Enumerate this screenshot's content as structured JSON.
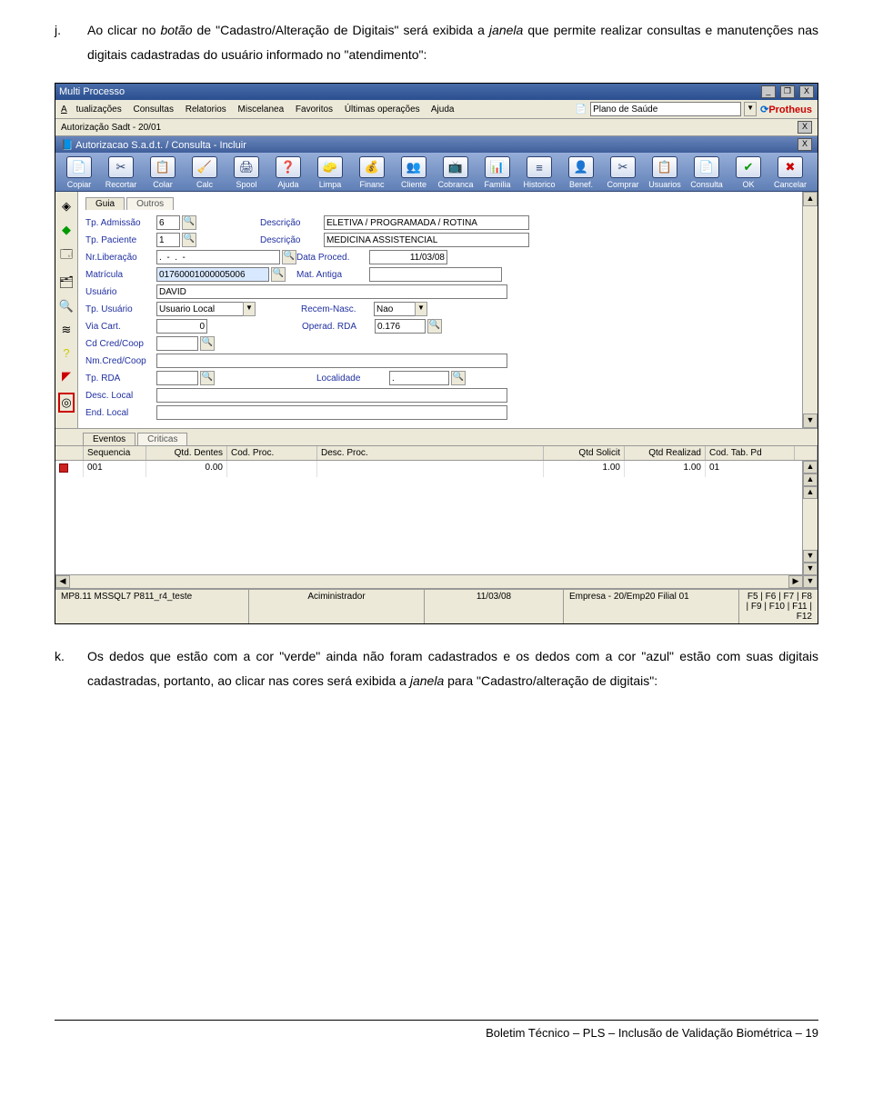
{
  "doc": {
    "j_marker": "j.",
    "j_text_1": "Ao clicar no ",
    "j_botao": "botão",
    "j_text_2": " de \"Cadastro/Alteração de Digitais\" será exibida a ",
    "j_janela": "janela",
    "j_text_3": " que permite realizar consultas e manutenções nas digitais cadastradas do usuário informado no \"atendimento\":",
    "k_marker": "k.",
    "k_text_1": "Os dedos que estão com a cor \"verde\" ainda não foram cadastrados e os dedos com a cor \"azul\" estão com suas digitais cadastradas, portanto, ao clicar nas cores será exibida a ",
    "k_janela": "janela",
    "k_text_2": " para \"Cadastro/alteração de digitais\":",
    "footer": "Boletim Técnico – PLS – Inclusão de Validação Biométrica – 19"
  },
  "app": {
    "title": "Multi Processo",
    "menu": {
      "m1": "Atualizações",
      "m2": "Consultas",
      "m3": "Relatorios",
      "m4": "Miscelanea",
      "m5": "Favoritos",
      "m6": "Últimas operações",
      "m7": "Ajuda"
    },
    "combo": "Plano de Saúde",
    "brand": "Protheus",
    "subtitle": "Autorização Sadt - 20/01",
    "wintitle": "Autorizacao S.a.d.t. / Consulta - Incluir",
    "toolbar": [
      "Copiar",
      "Recortar",
      "Colar",
      "Calc",
      "Spool",
      "Ajuda",
      "Limpa",
      "Financ",
      "Cliente",
      "Cobranca",
      "Familia",
      "Historico",
      "Benef.",
      "Comprar",
      "Usuarios",
      "Consulta",
      "OK",
      "Cancelar"
    ],
    "ticons": [
      "📄",
      "✂",
      "📋",
      "🧹",
      "🖨",
      "❓",
      "🧽",
      "💰",
      "👥",
      "📺",
      "📊",
      "≡",
      "👤",
      "✂",
      "📋",
      "📄",
      "✔",
      "✖"
    ],
    "tabs": {
      "guia": "Guia",
      "outros": "Outros"
    },
    "form": {
      "tpadm_l": "Tp. Admissão",
      "tpadm_v": "6",
      "desc1_l": "Descrição",
      "desc1_v": "ELETIVA / PROGRAMADA / ROTINA",
      "tppac_l": "Tp. Paciente",
      "tppac_v": "1",
      "desc2_l": "Descrição",
      "desc2_v": "MEDICINA ASSISTENCIAL",
      "nrlib_l": "Nr.Liberação",
      "nrlib_v": ".  -  .  -",
      "data_l": "Data Proced.",
      "data_v": "11/03/08",
      "mat_l": "Matrícula",
      "mat_v": "01760001000005006",
      "matant_l": "Mat. Antiga",
      "usu_l": "Usuário",
      "usu_v": "DAVID",
      "tpu_l": "Tp. Usuário",
      "tpu_v": "Usuario Local",
      "recn_l": "Recem-Nasc.",
      "recn_v": "Nao",
      "via_l": "Via Cart.",
      "via_v": "0",
      "oper_l": "Operad. RDA",
      "oper_v": "0.176",
      "cdc_l": "Cd Cred/Coop",
      "nmc_l": "Nm.Cred/Coop",
      "tpr_l": "Tp. RDA",
      "loc_l": "Localidade",
      "loc_v": ".",
      "dloc_l": "Desc. Local",
      "eloc_l": "End. Local"
    },
    "gtabs": {
      "ev": "Eventos",
      "cr": "Criticas"
    },
    "grid": {
      "h1": "Sequencia",
      "h2": "Qtd. Dentes",
      "h3": "Cod. Proc.",
      "h4": "Desc. Proc.",
      "h5": "Qtd Solicit",
      "h6": "Qtd Realizad",
      "h7": "Cod. Tab. Pd",
      "r_seq": "001",
      "r_qtd": "0.00",
      "r_sol": "1.00",
      "r_real": "1.00",
      "r_cod": "01"
    },
    "status": {
      "s1": "MP8.11  MSSQL7 P811_r4_teste",
      "s2": "Aciministrador",
      "s3": "11/03/08",
      "s4": "Empresa - 20/Emp20 Filial 01",
      "s5": "F5 | F6 | F7 | F8 | F9 | F10 | F11 | F12"
    }
  }
}
